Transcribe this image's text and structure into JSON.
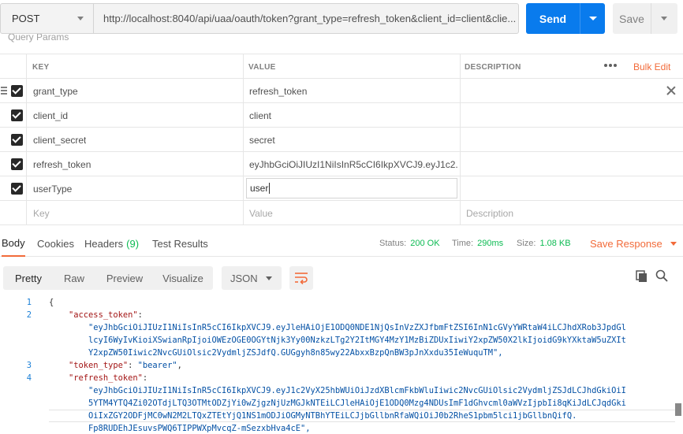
{
  "request": {
    "method": "POST",
    "url": "http://localhost:8040/api/uaa/oauth/token?grant_type=refresh_token&client_id=client&clie...",
    "send_label": "Send",
    "save_label": "Save",
    "section_title_clipped": "Query Params"
  },
  "params": {
    "headers": {
      "key": "KEY",
      "value": "VALUE",
      "description": "DESCRIPTION",
      "bulk_edit": "Bulk Edit"
    },
    "rows": [
      {
        "key": "grant_type",
        "value": "refresh_token",
        "checked": true
      },
      {
        "key": "client_id",
        "value": "client",
        "checked": true
      },
      {
        "key": "client_secret",
        "value": "secret",
        "checked": true
      },
      {
        "key": "refresh_token",
        "value": "eyJhbGciOiJIUzI1NiIsInR5cCI6IkpXVCJ9.eyJ1c2...",
        "checked": true
      },
      {
        "key": "userType",
        "value": "user",
        "checked": true
      }
    ],
    "placeholder": {
      "key": "Key",
      "value": "Value",
      "description": "Description"
    }
  },
  "response": {
    "tabs": [
      {
        "label": "Body"
      },
      {
        "label": "Cookies"
      },
      {
        "label": "Headers",
        "count": "(9)"
      },
      {
        "label": "Test Results"
      }
    ],
    "status_label": "Status:",
    "status_value": "200 OK",
    "time_label": "Time:",
    "time_value": "290ms",
    "size_label": "Size:",
    "size_value": "1.08 KB",
    "save_response": "Save Response",
    "views": [
      "Pretty",
      "Raw",
      "Preview",
      "Visualize"
    ],
    "format": "JSON"
  },
  "code": {
    "gutter": [
      "1",
      "2",
      "",
      "",
      "",
      "3",
      "4",
      "",
      "",
      "",
      ""
    ],
    "lines": [
      "{",
      "    \"access_token\":",
      "        \"eyJhbGciOiJIUzI1NiIsInR5cCI6IkpXVCJ9.eyJleHAiOjE1ODQ0NDE1NjQsInVzZXJfbmFtZSI6InN1cGVyYWRtaW4iLCJhdXRob3JpdGl",
      "        lcyI6WyIvKioiXSwianRpIjoiOWEzOGE0OGYtNjk3Yy00NzkzLTg2Y2ItMGY4MzY1MzBiZDUxIiwiY2xpZW50X2lkIjoidG9kYXktaW5uZXIt",
      "        Y2xpZW50Iiwic2NvcGUiOlsic2VydmljZSJdfQ.GUGgyh8n85wy22AbxxBzpQnBW3pJnXxdu35IeWuquTM\",",
      "    \"token_type\": \"bearer\",",
      "    \"refresh_token\":",
      "        \"eyJhbGciOiJIUzI1NiIsInR5cCI6IkpXVCJ9.eyJ1c2VyX25hbWUiOiJzdXBlcmFkbWluIiwic2NvcGUiOlsic2VydmljZSJdLCJhdGkiOiI",
      "        5YTM4YTQ4Zi02OTdjLTQ3OTMtODZjYi0wZjgzNjUzMGJkNTEiLCJleHAiOjE1ODQ0Mzg4NDUsImF1dGhvcml0aWVzIjpbIi8qKiJdLCJqdGki",
      "        OiIxZGY2ODFjMC0wN2M2LTQxZTEtYjQ1NS1mODJiOGMyNTBhYTEiLCJjbGllbnRfaWQiOiJ0b2RheS1pbm5lci1jbGllbnQifQ.",
      "        Fp8RUDEhJEsuvsPWQ6TIPPWXpMvcqZ-mSezxbHva4cE\","
    ]
  }
}
